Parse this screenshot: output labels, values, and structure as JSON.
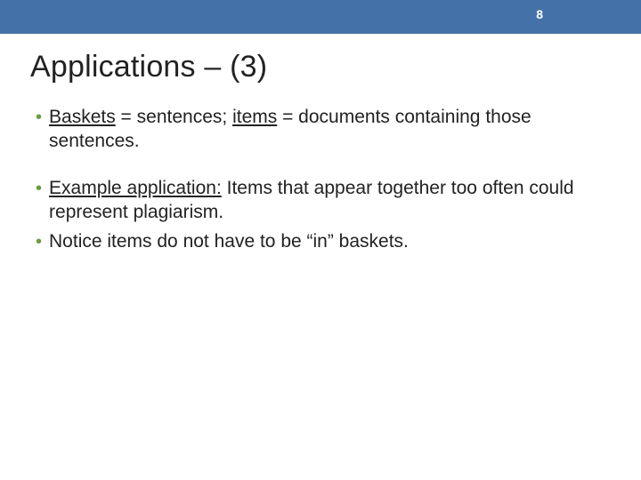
{
  "page_number": "8",
  "title": "Applications – (3)",
  "bullets": [
    {
      "parts": [
        {
          "t": "Baskets",
          "u": true
        },
        {
          "t": " = sentences; ",
          "u": false
        },
        {
          "t": "items",
          "u": true
        },
        {
          "t": " = documents containing those sentences.",
          "u": false
        }
      ]
    },
    {
      "gap": true
    },
    {
      "parts": [
        {
          "t": "Example application:",
          "u": true
        },
        {
          "t": " Items that appear together too often could represent plagiarism.",
          "u": false
        }
      ]
    },
    {
      "parts": [
        {
          "t": "Notice items do not have to be “in” baskets.",
          "u": false
        }
      ]
    }
  ]
}
